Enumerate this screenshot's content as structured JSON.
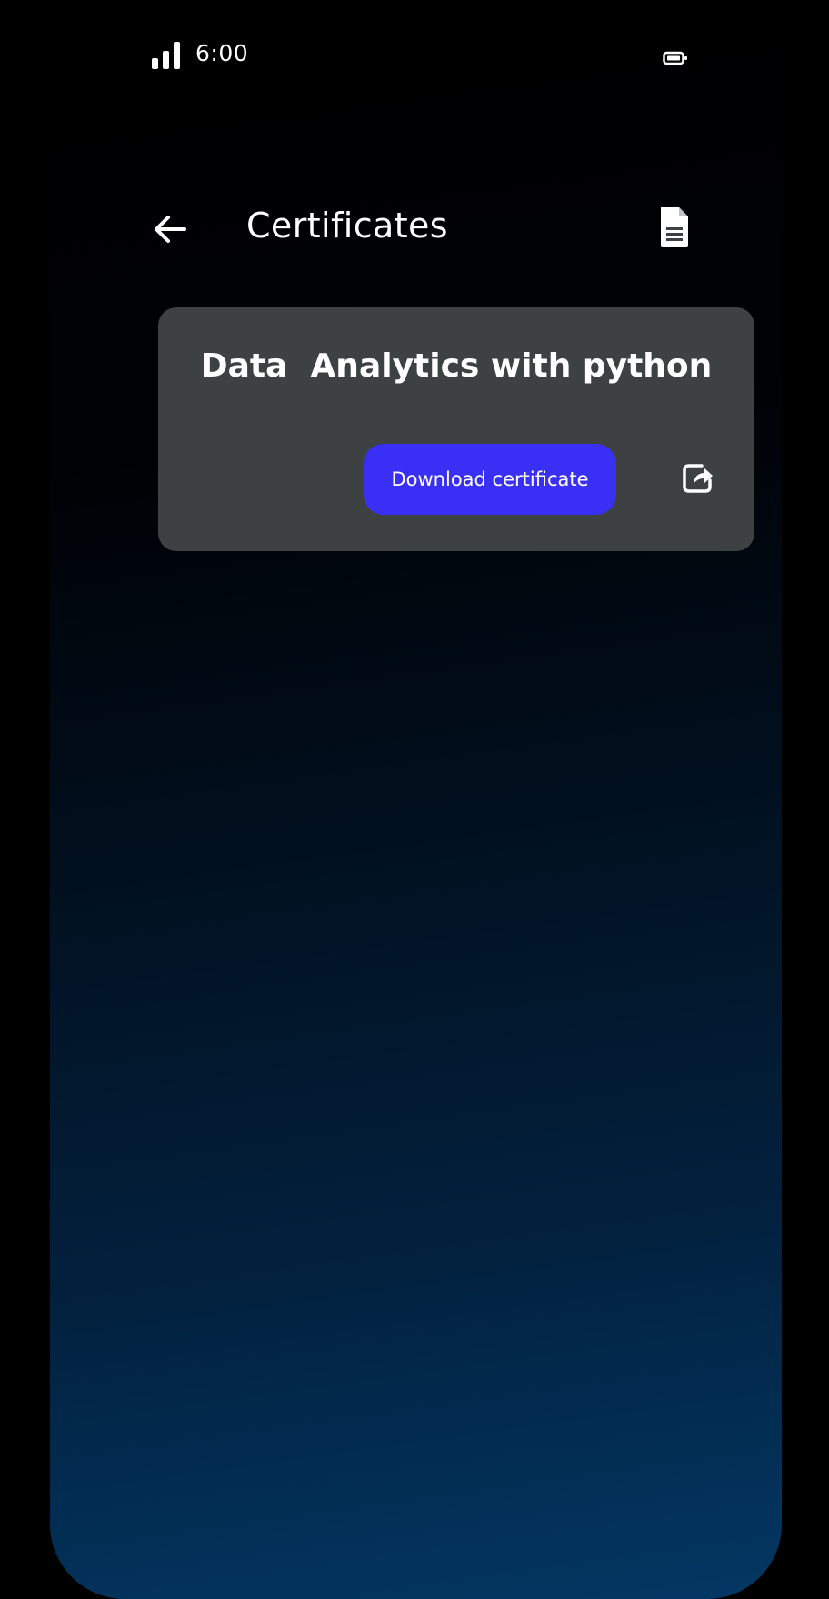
{
  "status_bar": {
    "time": "6:00",
    "signal_icon": "signal-bars-icon",
    "battery_icon": "battery-icon"
  },
  "header": {
    "title": "Certificates",
    "back_icon": "arrow-left-icon",
    "action_icon": "document-icon"
  },
  "certificate": {
    "course_title": "Data  Analytics with python",
    "download_label": "Download certificate",
    "share_icon": "share-icon"
  },
  "colors": {
    "card_background": "#3d4142",
    "button_accent": "#3a30f5",
    "text": "#ffffff",
    "gradient_top": "#000000",
    "gradient_bottom": "#033763"
  }
}
